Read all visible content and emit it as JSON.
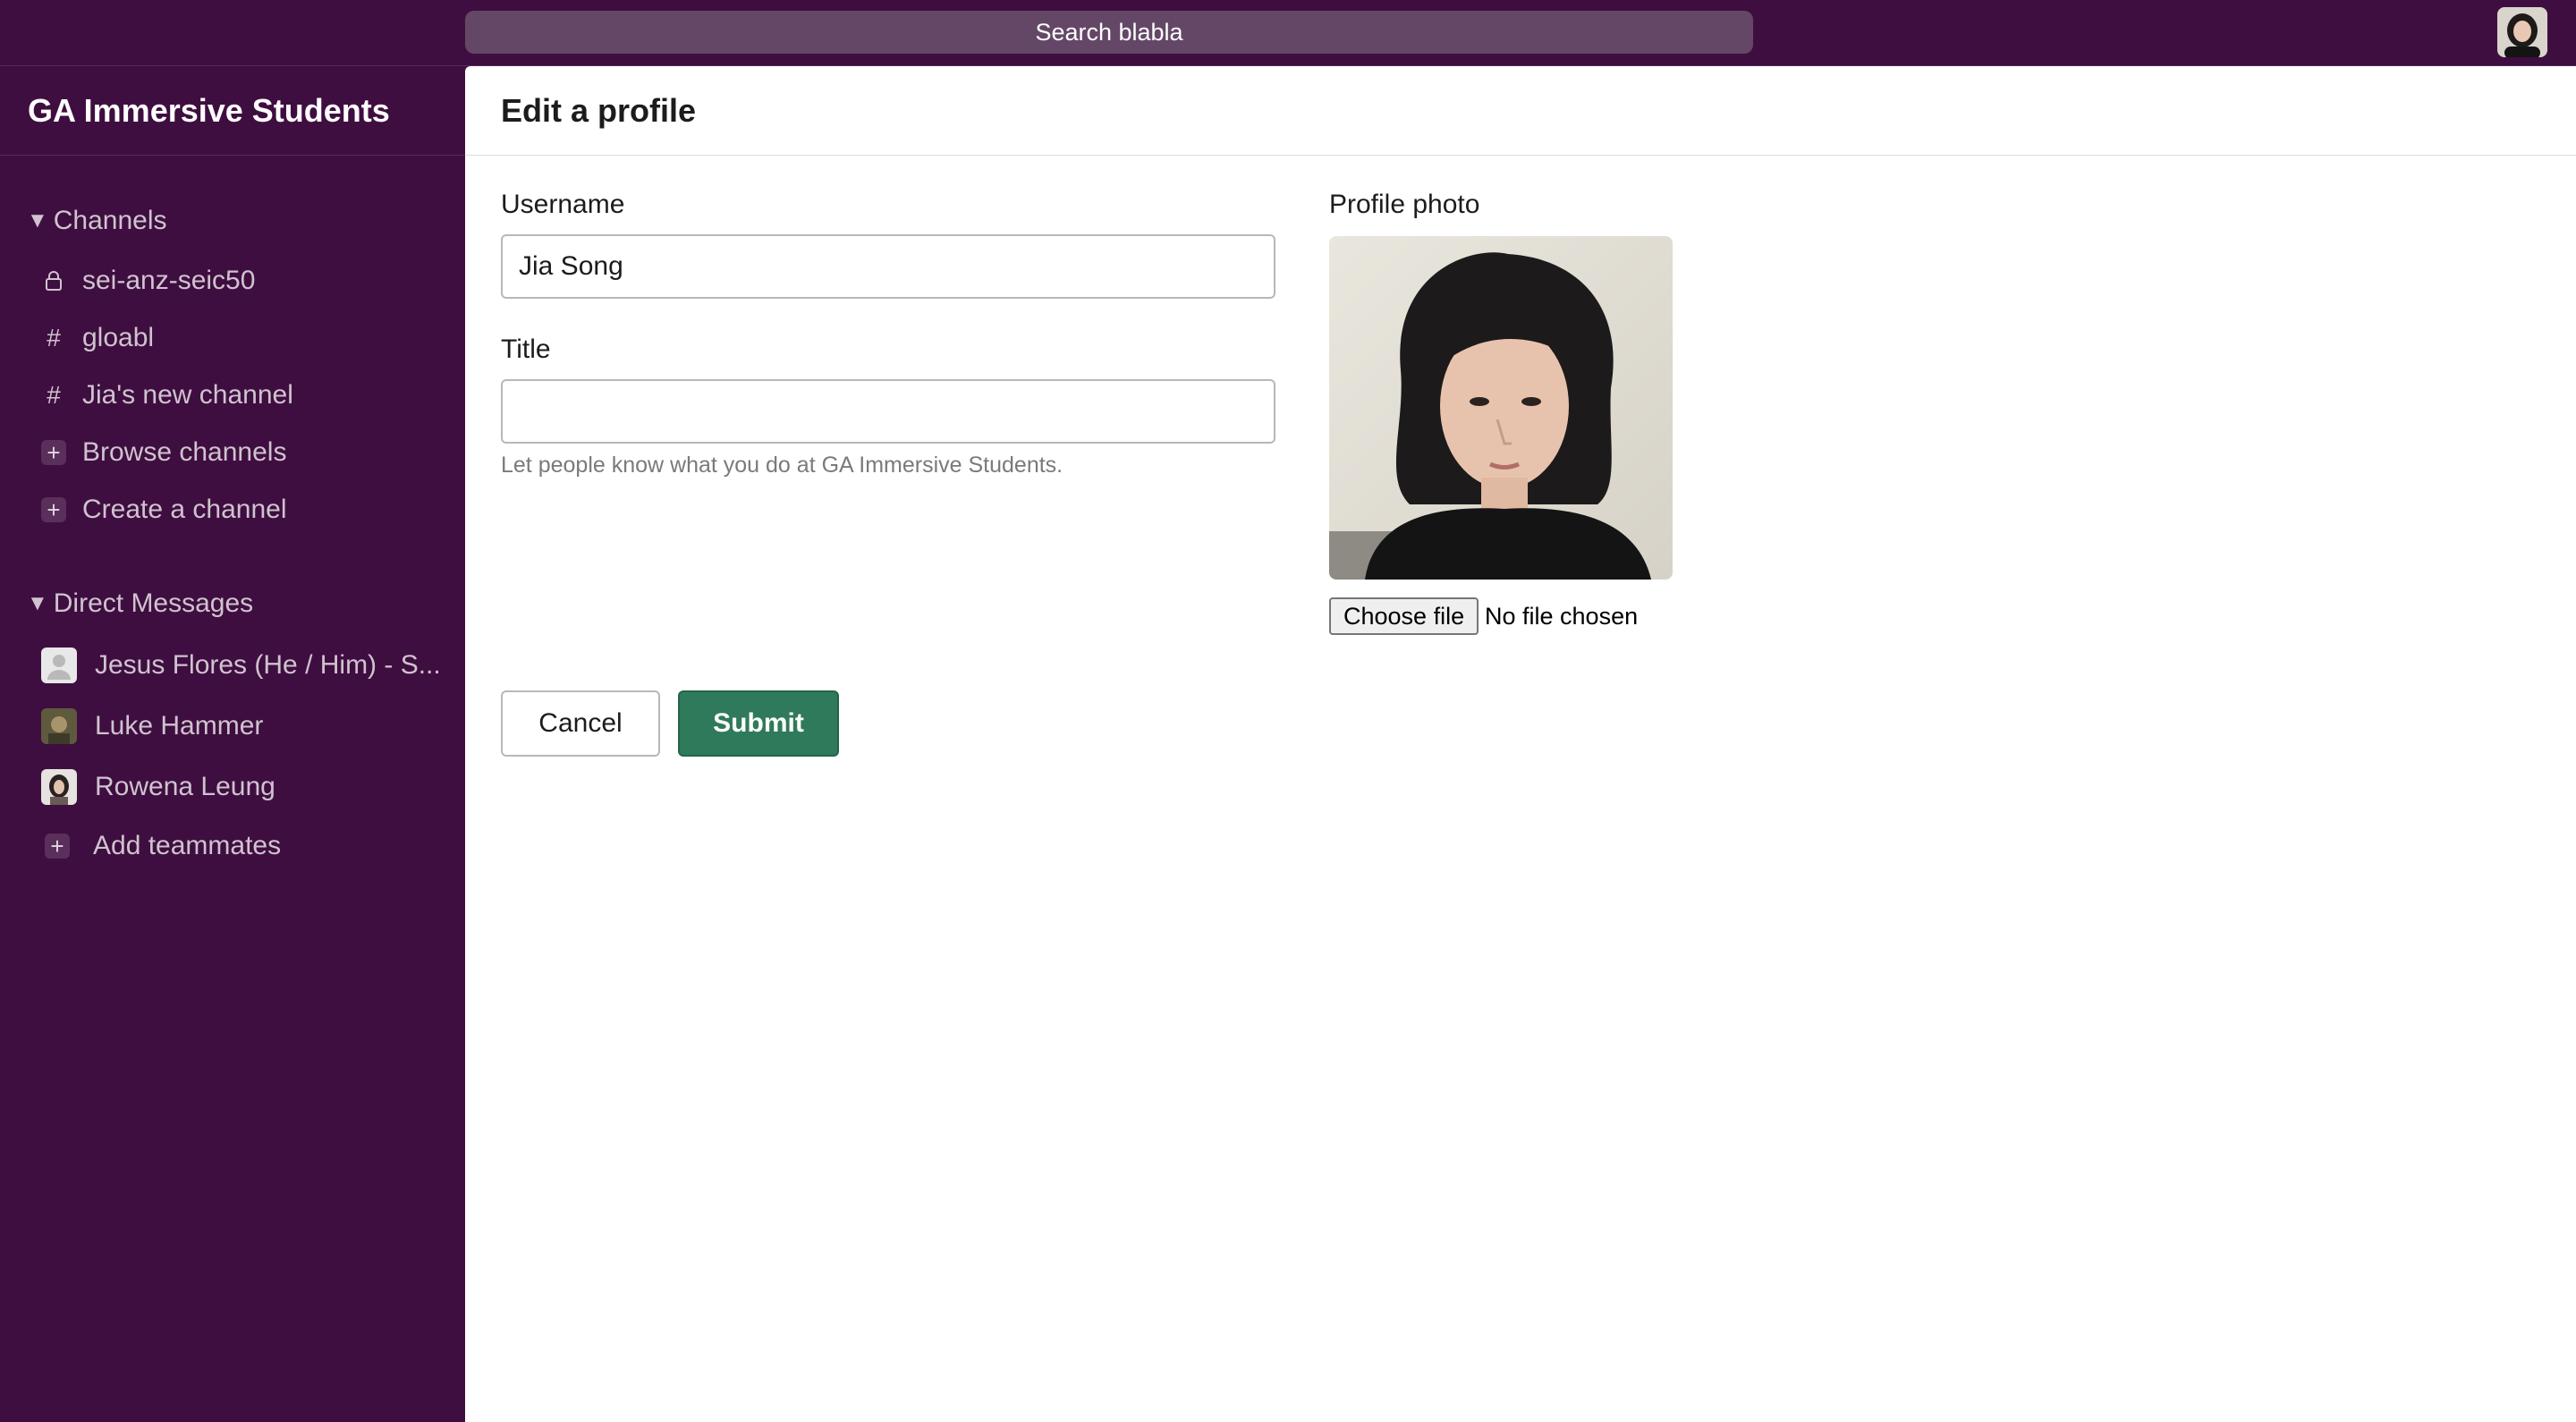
{
  "topbar": {
    "search_label": "Search blabla",
    "avatar_icon": "user-avatar-photo"
  },
  "sidebar": {
    "workspace_name": "GA Immersive Students",
    "channels_heading": "Channels",
    "channels": [
      {
        "icon": "lock-icon",
        "label": "sei-anz-seic50"
      },
      {
        "icon": "hash-icon",
        "label": "gloabl"
      },
      {
        "icon": "hash-icon",
        "label": "Jia's new channel"
      }
    ],
    "browse_channels": "Browse channels",
    "create_channel": "Create a channel",
    "dm_heading": "Direct Messages",
    "direct_messages": [
      {
        "label": "Jesus Flores (He / Him) - S..."
      },
      {
        "label": "Luke Hammer"
      },
      {
        "label": "Rowena Leung"
      }
    ],
    "add_teammates": "Add teammates"
  },
  "main": {
    "title": "Edit a profile",
    "username_label": "Username",
    "username_value": "Jia Song",
    "title_label": "Title",
    "title_value": "",
    "title_hint": "Let people know what you do at GA Immersive Students.",
    "photo_label": "Profile photo",
    "choose_file_label": "Choose file",
    "file_status": "No file chosen",
    "cancel_label": "Cancel",
    "submit_label": "Submit"
  },
  "colors": {
    "sidebar_bg": "#3f0e40",
    "search_bg": "#644767",
    "submit_bg": "#2f7a5a",
    "sidebar_text": "#cfc3cf"
  }
}
